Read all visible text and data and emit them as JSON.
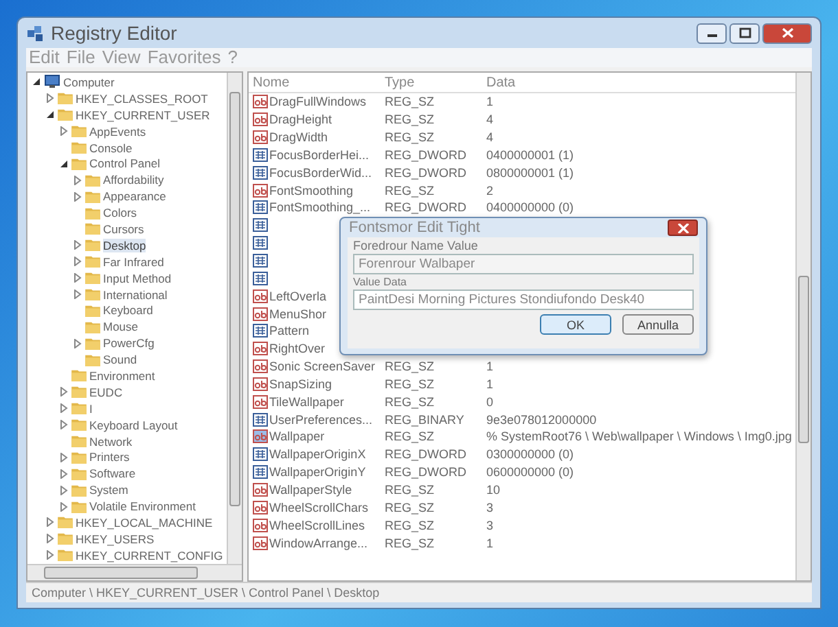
{
  "window": {
    "title": "Registry Editor"
  },
  "menu": [
    "Edit",
    "File",
    "View",
    "Favorites",
    "?"
  ],
  "tree": [
    {
      "label": "Computer",
      "kind": "computer",
      "expanded": true,
      "children": [
        {
          "label": "HKEY_CLASSES_ROOT",
          "expanded": false
        },
        {
          "label": "HKEY_CURRENT_USER",
          "expanded": true,
          "children": [
            {
              "label": "AppEvents",
              "expanded": false
            },
            {
              "label": "Console"
            },
            {
              "label": "Control Panel",
              "expanded": true,
              "children": [
                {
                  "label": "Affordability",
                  "expanded": false
                },
                {
                  "label": "Appearance",
                  "expanded": false
                },
                {
                  "label": "Colors"
                },
                {
                  "label": "Cursors"
                },
                {
                  "label": "Desktop",
                  "expanded": false,
                  "selected": true
                },
                {
                  "label": "Far Infrared",
                  "expanded": false
                },
                {
                  "label": "Input Method",
                  "expanded": false
                },
                {
                  "label": "International",
                  "expanded": false
                },
                {
                  "label": "Keyboard"
                },
                {
                  "label": "Mouse"
                },
                {
                  "label": "PowerCfg",
                  "expanded": false
                },
                {
                  "label": "Sound"
                }
              ]
            },
            {
              "label": "Environment"
            },
            {
              "label": "EUDC",
              "expanded": false
            },
            {
              "label": "I",
              "expanded": false
            },
            {
              "label": "Keyboard Layout",
              "expanded": false
            },
            {
              "label": "Network"
            },
            {
              "label": "Printers",
              "expanded": false
            },
            {
              "label": "Software",
              "expanded": false
            },
            {
              "label": "System",
              "expanded": false
            },
            {
              "label": "Volatile Environment",
              "expanded": false
            }
          ]
        },
        {
          "label": "HKEY_LOCAL_MACHINE",
          "expanded": false
        },
        {
          "label": "HKEY_USERS",
          "expanded": false
        },
        {
          "label": "HKEY_CURRENT_CONFIG",
          "expanded": false
        }
      ]
    }
  ],
  "table": {
    "columns": [
      "Nome",
      "Type",
      "Data"
    ],
    "rows": [
      {
        "kind": "sz",
        "name": "DragFullWindows",
        "type": "REG_SZ",
        "data": "1",
        "selected": false
      },
      {
        "kind": "sz",
        "name": "DragHeight",
        "type": "REG_SZ",
        "data": "4",
        "selected": false
      },
      {
        "kind": "sz",
        "name": "DragWidth",
        "type": "REG_SZ",
        "data": "4",
        "selected": false
      },
      {
        "kind": "dword",
        "name": "FocusBorderHei...",
        "type": "REG_DWORD",
        "data": "0400000001 (1)",
        "selected": false
      },
      {
        "kind": "dword",
        "name": "FocusBorderWid...",
        "type": "REG_DWORD",
        "data": "0800000001 (1)",
        "selected": false
      },
      {
        "kind": "sz",
        "name": "FontSmoothing",
        "type": "REG_SZ",
        "data": "2",
        "selected": false
      },
      {
        "kind": "dword",
        "name": "FontSmoothing_...",
        "type": "REG_DWORD",
        "data": "0400000000 (0)",
        "selected": false
      },
      {
        "kind": "dword",
        "selected": false
      },
      {
        "kind": "dword",
        "selected": false
      },
      {
        "kind": "dword",
        "selected": false
      },
      {
        "kind": "dword",
        "selected": false
      },
      {
        "kind": "sz",
        "name": "LeftOverla",
        "selected": false
      },
      {
        "kind": "sz",
        "name": "MenuShor",
        "selected": false
      },
      {
        "kind": "dword",
        "name": "Pattern",
        "selected": false
      },
      {
        "kind": "sz",
        "name": "RightOver",
        "selected": false
      },
      {
        "kind": "sz",
        "name": "Sonic ScreenSaver",
        "type": "REG_SZ",
        "data": "1",
        "selected": false
      },
      {
        "kind": "sz",
        "name": "SnapSizing",
        "type": "REG_SZ",
        "data": "1",
        "selected": false
      },
      {
        "kind": "sz",
        "name": "TileWallpaper",
        "type": "REG_SZ",
        "data": "0",
        "selected": false
      },
      {
        "kind": "binary",
        "name": "UserPreferences...",
        "type": "REG_BINARY",
        "data": "9e3e078012000000",
        "selected": false
      },
      {
        "kind": "sz",
        "name": "Wallpaper",
        "type": "REG_SZ",
        "data": "% SystemRoot76 \\ Web\\wallpaper \\ Windows \\ Img0.jpg",
        "selected": true
      },
      {
        "kind": "dword",
        "name": "WallpaperOriginX",
        "type": "REG_DWORD",
        "data": "0300000000 (0)",
        "selected": false
      },
      {
        "kind": "dword",
        "name": "WallpaperOriginY",
        "type": "REG_DWORD",
        "data": "0600000000 (0)",
        "selected": false
      },
      {
        "kind": "sz",
        "name": "WallpaperStyle",
        "type": "REG_SZ",
        "data": "10",
        "selected": false
      },
      {
        "kind": "sz",
        "name": "WheelScrollChars",
        "type": "REG_SZ",
        "data": "3",
        "selected": false
      },
      {
        "kind": "sz",
        "name": "WheelScrollLines",
        "type": "REG_SZ",
        "data": "3",
        "selected": false
      },
      {
        "kind": "sz",
        "name": "WindowArrange...",
        "type": "REG_SZ",
        "data": "1",
        "selected": false
      }
    ]
  },
  "dialog": {
    "title": "Fontsmor Edit Tight",
    "name_label": "Foredrour Name Value",
    "name_value": "Forenrour Walbaper",
    "data_label": "Value Data",
    "data_value": "PaintDesi Morning Pictures Stondiufondo Desk40",
    "buttons": [
      {
        "label": "OK",
        "selected": true
      },
      {
        "label": "Annulla",
        "selected": false
      }
    ]
  },
  "status_bar": "Computer \\ HKEY_CURRENT_USER \\ Control Panel \\ Desktop"
}
